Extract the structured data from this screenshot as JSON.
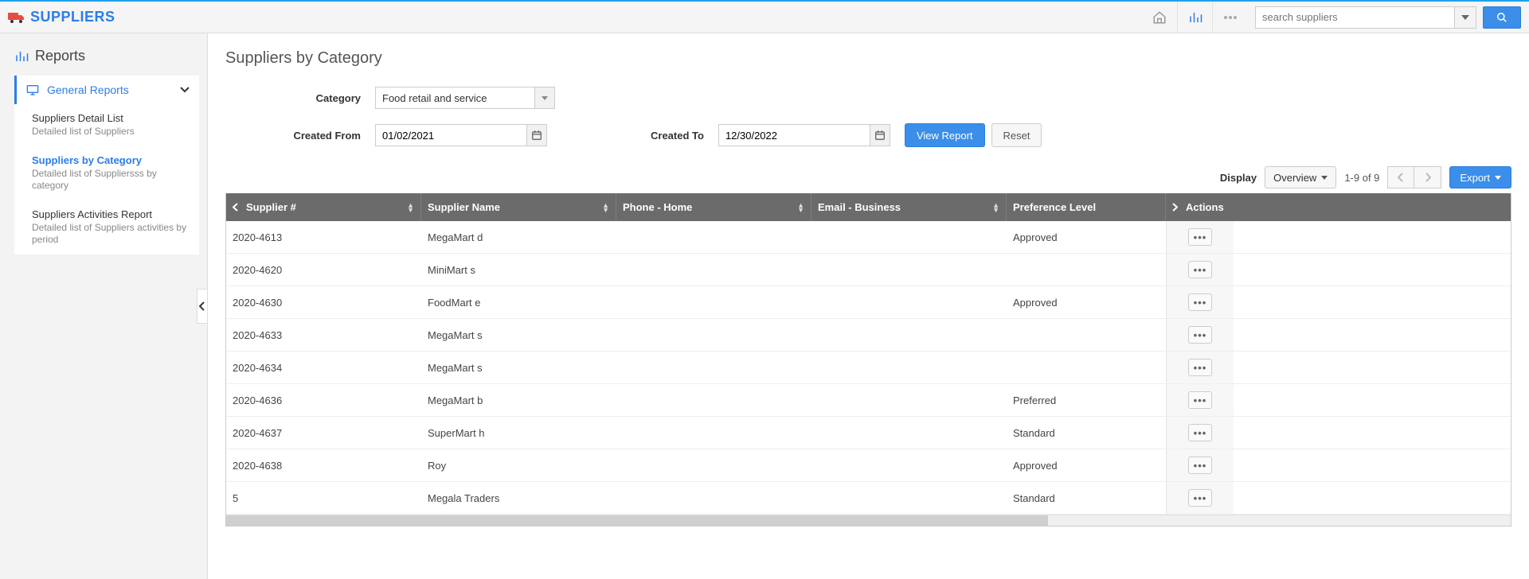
{
  "brand": {
    "title": "SUPPLIERS"
  },
  "search": {
    "placeholder": "search suppliers"
  },
  "sidebar": {
    "title": "Reports",
    "group_label": "General Reports",
    "items": [
      {
        "title": "Suppliers Detail List",
        "desc": "Detailed list of Suppliers",
        "active": false
      },
      {
        "title": "Suppliers by Category",
        "desc": "Detailed list of Suppliersss by category",
        "active": true
      },
      {
        "title": "Suppliers Activities Report",
        "desc": "Detailed list of Suppliers activities by period",
        "active": false
      }
    ]
  },
  "page": {
    "title": "Suppliers by Category"
  },
  "filters": {
    "category_label": "Category",
    "category_value": "Food retail and service",
    "created_from_label": "Created From",
    "created_from_value": "01/02/2021",
    "created_to_label": "Created To",
    "created_to_value": "12/30/2022",
    "view_report_label": "View Report",
    "reset_label": "Reset"
  },
  "toolbar": {
    "display_label": "Display",
    "display_value": "Overview",
    "count_text": "1-9 of 9",
    "export_label": "Export"
  },
  "table": {
    "columns": {
      "supplier_no": "Supplier #",
      "supplier_name": "Supplier Name",
      "phone_home": "Phone - Home",
      "email_business": "Email - Business",
      "preference_level": "Preference Level",
      "actions": "Actions"
    },
    "rows": [
      {
        "no": "2020-4613",
        "name": "MegaMart d",
        "phone": "",
        "email": "",
        "pref": "Approved"
      },
      {
        "no": "2020-4620",
        "name": "MiniMart s",
        "phone": "",
        "email": "",
        "pref": ""
      },
      {
        "no": "2020-4630",
        "name": "FoodMart e",
        "phone": "",
        "email": "",
        "pref": "Approved"
      },
      {
        "no": "2020-4633",
        "name": "MegaMart s",
        "phone": "",
        "email": "",
        "pref": ""
      },
      {
        "no": "2020-4634",
        "name": "MegaMart s",
        "phone": "",
        "email": "",
        "pref": ""
      },
      {
        "no": "2020-4636",
        "name": "MegaMart b",
        "phone": "",
        "email": "",
        "pref": "Preferred"
      },
      {
        "no": "2020-4637",
        "name": "SuperMart h",
        "phone": "",
        "email": "",
        "pref": "Standard"
      },
      {
        "no": "2020-4638",
        "name": "Roy",
        "phone": "",
        "email": "",
        "pref": "Approved"
      },
      {
        "no": "5",
        "name": "Megala Traders",
        "phone": "",
        "email": "",
        "pref": "Standard"
      }
    ]
  }
}
